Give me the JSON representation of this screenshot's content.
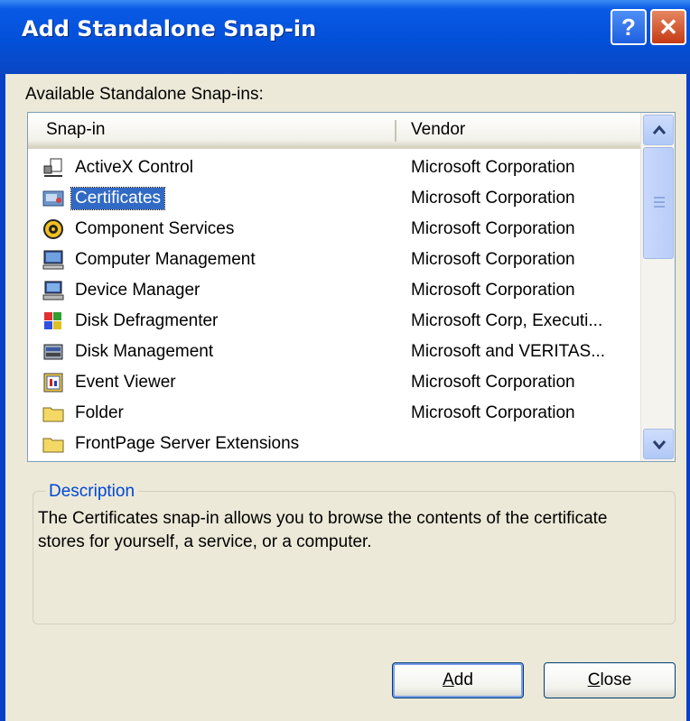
{
  "window": {
    "title": "Add Standalone Snap-in"
  },
  "titlebar": {
    "help_label": "?",
    "close_label": "✕"
  },
  "list_label": "Available Standalone Snap-ins:",
  "columns": {
    "snapin": "Snap-in",
    "vendor": "Vendor"
  },
  "rows": [
    {
      "name": "ActiveX Control",
      "vendor": "Microsoft Corporation",
      "icon": "activex-control-icon"
    },
    {
      "name": "Certificates",
      "vendor": "Microsoft Corporation",
      "icon": "certificates-icon",
      "selected": true
    },
    {
      "name": "Component Services",
      "vendor": "Microsoft Corporation",
      "icon": "component-services-icon"
    },
    {
      "name": "Computer Management",
      "vendor": "Microsoft Corporation",
      "icon": "computer-management-icon"
    },
    {
      "name": "Device Manager",
      "vendor": "Microsoft Corporation",
      "icon": "device-manager-icon"
    },
    {
      "name": "Disk Defragmenter",
      "vendor": "Microsoft Corp, Executi...",
      "icon": "disk-defragmenter-icon"
    },
    {
      "name": "Disk Management",
      "vendor": "Microsoft and VERITAS...",
      "icon": "disk-management-icon"
    },
    {
      "name": "Event Viewer",
      "vendor": "Microsoft Corporation",
      "icon": "event-viewer-icon"
    },
    {
      "name": "Folder",
      "vendor": "Microsoft Corporation",
      "icon": "folder-icon"
    },
    {
      "name": "FrontPage Server Extensions",
      "vendor": "",
      "icon": "folder-icon"
    }
  ],
  "description": {
    "legend": "Description",
    "text": "The Certificates snap-in allows you to browse the contents of the certificate stores for yourself, a service, or a computer."
  },
  "buttons": {
    "add_first": "A",
    "add_rest": "dd",
    "close_first": "C",
    "close_rest": "lose"
  },
  "colors": {
    "selection": "#316AC5",
    "titlebar": "#0A5AE6",
    "dialog_bg": "#ECE9D8",
    "legend": "#0046D5"
  }
}
